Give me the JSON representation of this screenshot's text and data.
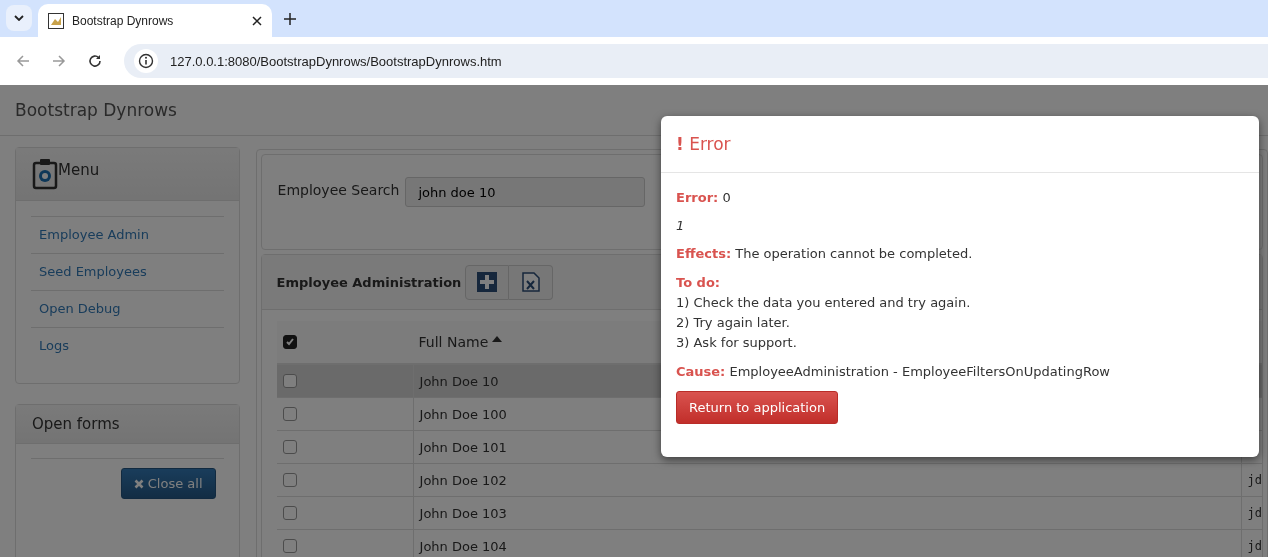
{
  "browser": {
    "tabs": [
      {
        "title": "Bootstrap Dynrows",
        "selected": true
      }
    ],
    "address": "127.0.0.1:8080/BootstrapDynrows/BootstrapDynrows.htm"
  },
  "app_title": "Bootstrap Dynrows",
  "menu": {
    "title": "Menu",
    "items": [
      "Employee Admin",
      "Seed Employees",
      "Open Debug",
      "Logs"
    ]
  },
  "open_forms": {
    "title": "Open forms",
    "button": "Close all"
  },
  "search": {
    "label": "Employee Search",
    "value": "john doe 10"
  },
  "admin": {
    "title": "Employee Administration"
  },
  "table": {
    "header_checked": true,
    "columns": [
      {
        "label": "Full Name",
        "sorted": true
      }
    ],
    "rows": [
      {
        "checked": false,
        "selected": true,
        "full_name": "John Doe 10"
      },
      {
        "checked": false,
        "selected": false,
        "full_name": "John Doe 100"
      },
      {
        "checked": false,
        "selected": false,
        "full_name": "John Doe 101"
      },
      {
        "checked": false,
        "selected": false,
        "full_name": "John Doe 102",
        "column_3": "jd"
      },
      {
        "checked": false,
        "selected": false,
        "full_name": "John Doe 103",
        "column_3": "jd"
      },
      {
        "checked": false,
        "selected": false,
        "full_name": "John Doe 104",
        "column_3": "jd"
      }
    ]
  },
  "dialog": {
    "icon": "!",
    "title": "Error",
    "error_label": "Error:",
    "error_value": "0",
    "detail": "1",
    "effects_label": "Effects:",
    "effects_text": "The operation cannot be completed.",
    "todo_label": "To do:",
    "todo_items": [
      "1) Check the data you entered and try again.",
      "2) Try again later.",
      "3) Ask for support."
    ],
    "cause_label": "Cause:",
    "cause_text": "EmployeeAdministration - EmployeeFiltersOnUpdatingRow",
    "button": "Return to application"
  }
}
